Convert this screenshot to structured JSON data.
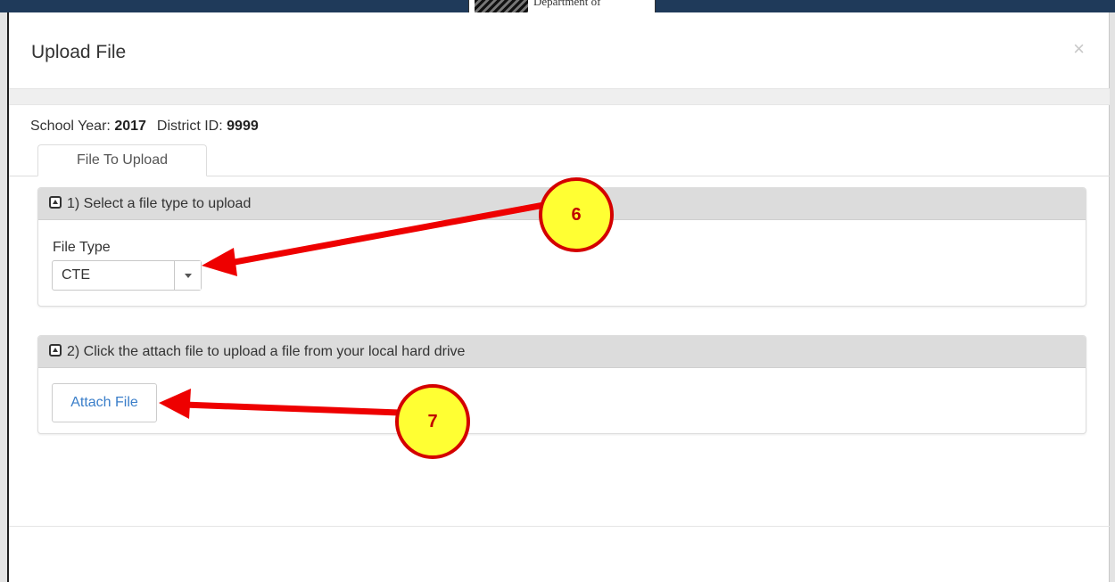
{
  "background": {
    "logo_text": "Department of"
  },
  "modal": {
    "title": "Upload File",
    "close_label": "×",
    "info": {
      "school_year_label": "School Year:",
      "school_year_value": "2017",
      "district_label": "District ID:",
      "district_value": "9999"
    },
    "tab_label": "File To Upload",
    "section1": {
      "header": "1) Select a file type to upload",
      "field_label": "File Type",
      "selected_value": "CTE"
    },
    "section2": {
      "header": "2) Click the attach file to upload a file from your local hard drive",
      "button_label": "Attach File"
    }
  },
  "annotations": {
    "callout_6": "6",
    "callout_7": "7",
    "callout_fill": "#ffff33",
    "callout_border": "#d40000",
    "arrow_color": "#ee0000"
  }
}
